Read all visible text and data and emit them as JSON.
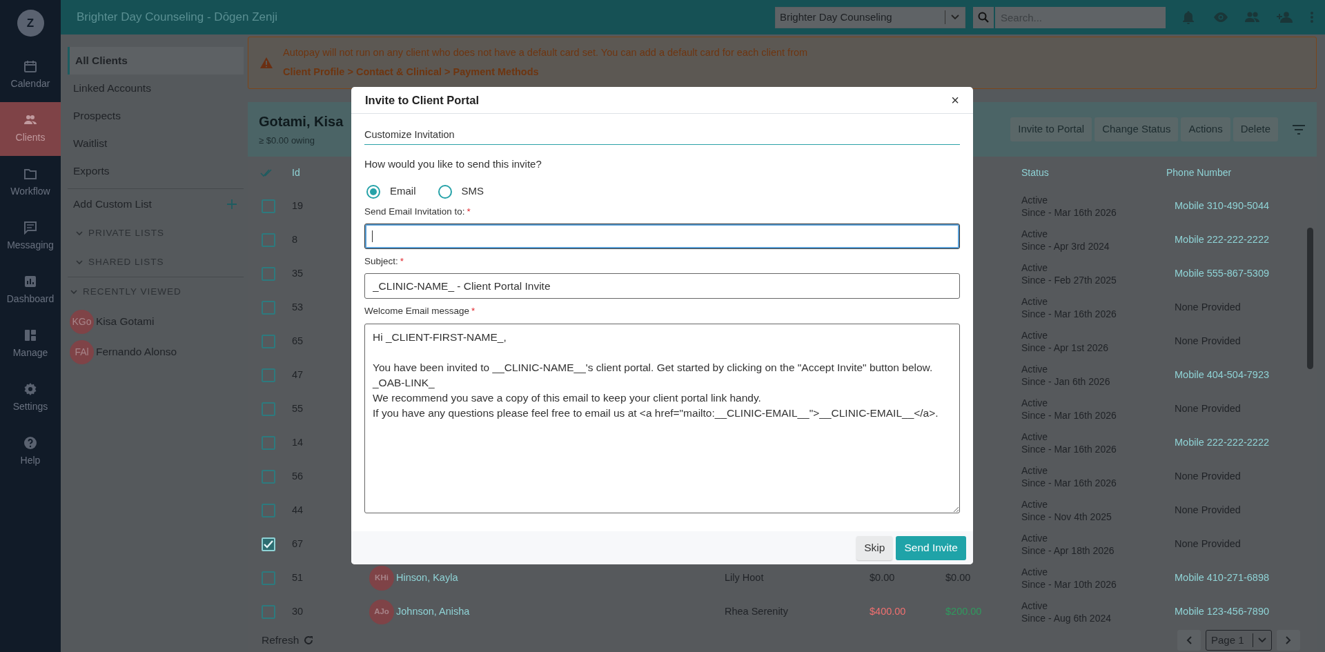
{
  "nav_rail": {
    "logo": "Z",
    "items": [
      {
        "label": "Calendar",
        "selected": false
      },
      {
        "label": "Clients",
        "selected": true
      },
      {
        "label": "Workflow",
        "selected": false
      },
      {
        "label": "Messaging",
        "selected": false
      },
      {
        "label": "Dashboard",
        "selected": false
      },
      {
        "label": "Manage",
        "selected": false
      },
      {
        "label": "Settings",
        "selected": false
      },
      {
        "label": "Help",
        "selected": false
      }
    ]
  },
  "top_bar": {
    "title": "Brighter Day Counseling - Dōgen Zenji",
    "clinic_select": "Brighter Day Counseling",
    "search": {
      "placeholder": "Search..."
    }
  },
  "list_panel": {
    "items": [
      {
        "label": "All Clients",
        "selected": true
      },
      {
        "label": "Linked Accounts",
        "selected": false
      },
      {
        "label": "Prospects",
        "selected": false
      },
      {
        "label": "Waitlist",
        "selected": false
      },
      {
        "label": "Exports",
        "selected": false
      }
    ],
    "add_custom_list": "Add Custom List",
    "sections": [
      {
        "label": "PRIVATE LISTS"
      },
      {
        "label": "SHARED LISTS"
      }
    ],
    "recently_viewed": {
      "label": "RECENTLY VIEWED",
      "items": [
        {
          "initials": "KGo",
          "name": "Kisa Gotami"
        },
        {
          "initials": "FAl",
          "name": "Fernando Alonso"
        }
      ]
    }
  },
  "alert": {
    "text": "Autopay will not run on any client who does not have a default card set. You can add a default card for each client from",
    "path": "Client Profile > Contact & Clinical > Payment Methods"
  },
  "client_header": {
    "name": "Gotami, Kisa",
    "owing": "≥ $0.00 owing",
    "buttons": [
      "Invite to Portal",
      "Change Status",
      "Actions",
      "Delete"
    ]
  },
  "table": {
    "columns": [
      {
        "label": "Id"
      },
      {
        "label": "Status"
      },
      {
        "label": "Phone Number"
      }
    ],
    "rows": [
      {
        "checked": false,
        "id": "19",
        "status": "Active",
        "since": "Since - Mar 16th 2026",
        "phone": {
          "text": "Mobile 310-490-5044",
          "linked": true
        }
      },
      {
        "checked": false,
        "id": "8",
        "status": "Active",
        "since": "Since - Apr 3rd 2024",
        "phone": {
          "text": "Mobile 222-222-2222",
          "linked": true
        }
      },
      {
        "checked": false,
        "id": "35",
        "status": "Active",
        "since": "Since - Feb 27th 2025",
        "phone": {
          "text": "Mobile 555-867-5309",
          "linked": true
        }
      },
      {
        "checked": false,
        "id": "53",
        "status": "Active",
        "since": "Since - Mar 16th 2026",
        "phone": {
          "text": "None Provided",
          "linked": false
        }
      },
      {
        "checked": false,
        "id": "65",
        "status": "Active",
        "since": "Since - Apr 1st 2026",
        "phone": {
          "text": "None Provided",
          "linked": false
        }
      },
      {
        "checked": false,
        "id": "47",
        "status": "Active",
        "since": "Since - Jan 6th 2026",
        "phone": {
          "text": "Mobile 404-504-7923",
          "linked": true
        }
      },
      {
        "checked": false,
        "id": "55",
        "status": "Active",
        "since": "Since - Mar 16th 2026",
        "phone": {
          "text": "None Provided",
          "linked": false
        }
      },
      {
        "checked": false,
        "id": "14",
        "status": "Active",
        "since": "Since - Mar 16th 2026",
        "phone": {
          "text": "Mobile 222-222-2222",
          "linked": true
        }
      },
      {
        "checked": false,
        "id": "56",
        "status": "Active",
        "since": "Since - Mar 16th 2026",
        "phone": {
          "text": "None Provided",
          "linked": false
        }
      },
      {
        "checked": false,
        "id": "44",
        "status": "Active",
        "since": "Since - Nov 4th 2025",
        "phone": {
          "text": "None Provided",
          "linked": false
        }
      },
      {
        "checked": true,
        "id": "67",
        "status": "Active",
        "since": "Since - Apr 18th 2026",
        "phone": {
          "text": "None Provided",
          "linked": false
        }
      },
      {
        "checked": false,
        "id": "51",
        "initials": "KHi",
        "name": "Hinson, Kayla",
        "therapist": "Lily Hoot",
        "balance": {
          "text": "$0.00",
          "color": "#1f2226"
        },
        "credit": {
          "text": "$0.00",
          "color": "#1f2226"
        },
        "status": "Active",
        "since": "Since - Mar 10th 2026",
        "phone": {
          "text": "Mobile 410-271-6898",
          "linked": true
        }
      },
      {
        "checked": false,
        "id": "30",
        "initials": "AJo",
        "name": "Johnson, Anisha",
        "therapist": "Rhea Serenity",
        "balance": {
          "text": "$400.00",
          "color": "#f07070"
        },
        "credit": {
          "text": "$200.00",
          "color": "#2f9a5e"
        },
        "status": "Active",
        "since": "Since - Aug 6th 2024",
        "phone": {
          "text": "Mobile 123-456-7890",
          "linked": true
        }
      }
    ]
  },
  "footer": {
    "refresh": "Refresh",
    "page_select": "Page 1"
  },
  "modal": {
    "title": "Invite to Client Portal",
    "close": "×",
    "section": "Customize Invitation",
    "question": "How would you like to send this invite?",
    "methods": [
      {
        "label": "Email",
        "selected": true
      },
      {
        "label": "SMS",
        "selected": false
      }
    ],
    "fields": [
      {
        "kind": "input",
        "label": "Send Email Invitation to:",
        "required_mark": "*",
        "focused": true
      },
      {
        "kind": "input",
        "label": "Subject:",
        "required_mark": "*",
        "value": "_CLINIC-NAME_ - Client Portal Invite",
        "focused": false
      },
      {
        "kind": "textarea",
        "label": "Welcome Email message",
        "required_mark": "*",
        "value": "Hi _CLIENT-FIRST-NAME_,\n\nYou have been invited to __CLINIC-NAME__'s client portal. Get started by clicking on the \"Accept Invite\" button below.\n_OAB-LINK_\nWe recommend you save a copy of this email to keep your client portal link handy.\nIf you have any questions please feel free to email us at <a href=\"mailto:__CLINIC-EMAIL__\">__CLINIC-EMAIL__</a>.",
        "focused": false
      }
    ],
    "buttons": [
      {
        "label": "Skip",
        "kind": "secondary"
      },
      {
        "label": "Send Invite",
        "kind": "primary"
      }
    ]
  }
}
